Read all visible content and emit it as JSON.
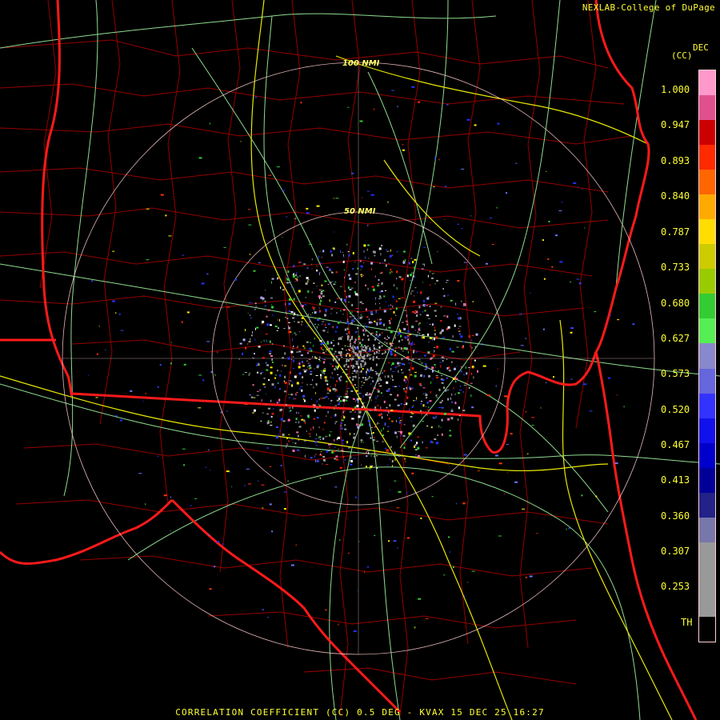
{
  "credit": "NEXLAB-College of DuPage",
  "legend": {
    "title_line1": "DEC",
    "title_line2": "(CC)",
    "labels": [
      "1.000",
      "0.947",
      "0.893",
      "0.840",
      "0.787",
      "0.733",
      "0.680",
      "0.627",
      "0.573",
      "0.520",
      "0.467",
      "0.413",
      "0.360",
      "0.307",
      "0.253",
      "TH"
    ],
    "colors": [
      "#ff99cc",
      "#e0508f",
      "#cc0000",
      "#ff2a00",
      "#ff6600",
      "#ffaa00",
      "#ffdd00",
      "#cccc00",
      "#99cc00",
      "#33cc33",
      "#55ee55",
      "#8888cc",
      "#6666dd",
      "#3333ff",
      "#1111ee",
      "#0000cc",
      "#000099",
      "#222288",
      "#7777aa",
      "#999999",
      "#999999",
      "#999999",
      "#000000"
    ]
  },
  "range_rings": [
    "50 NMI",
    "100 NMI"
  ],
  "footer": "CORRELATION COEFFICIENT (CC) 0.5 DEG - KVAX 15 DEC 25 16:27"
}
